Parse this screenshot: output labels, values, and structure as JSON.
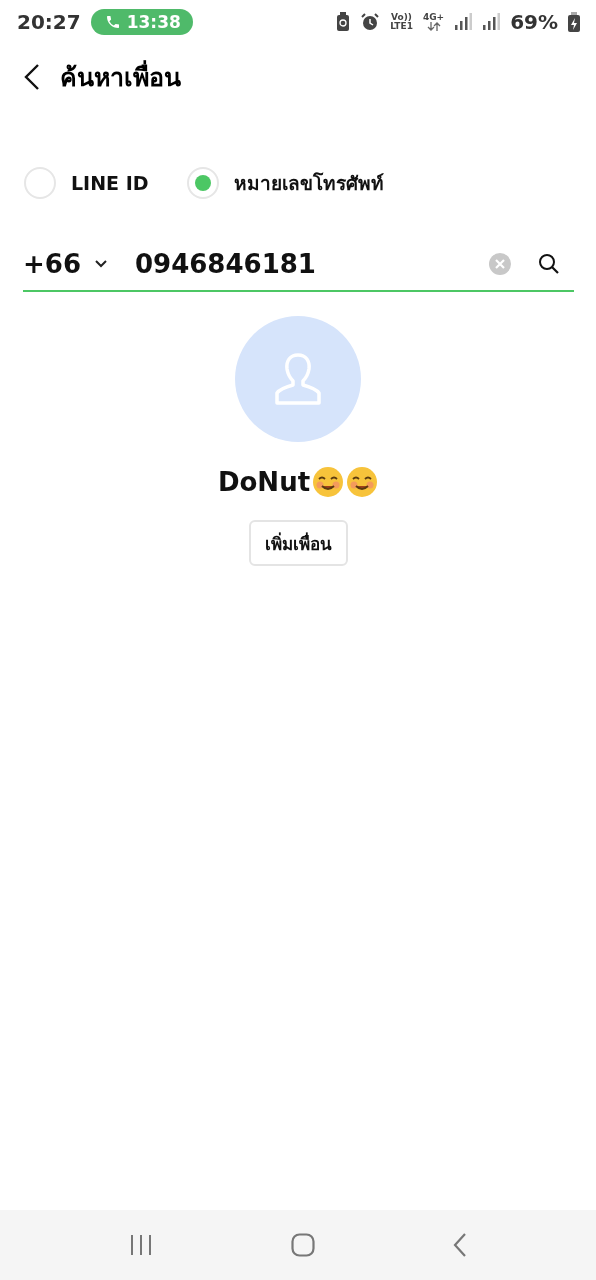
{
  "status_bar": {
    "time": "20:27",
    "call_time": "13:38",
    "volte": "Vo))",
    "lte": "LTE1",
    "network": "4G+",
    "battery": "69%"
  },
  "header": {
    "title": "ค้นหาเพื่อน"
  },
  "search_type": [
    {
      "label": "LINE ID",
      "selected": false
    },
    {
      "label": "หมายเลขโทรศัพท์",
      "selected": true
    }
  ],
  "phone_search": {
    "country_code": "+66",
    "value": "0946846181"
  },
  "result": {
    "name": "DoNut",
    "button": "เพิ่มเพื่อน"
  }
}
